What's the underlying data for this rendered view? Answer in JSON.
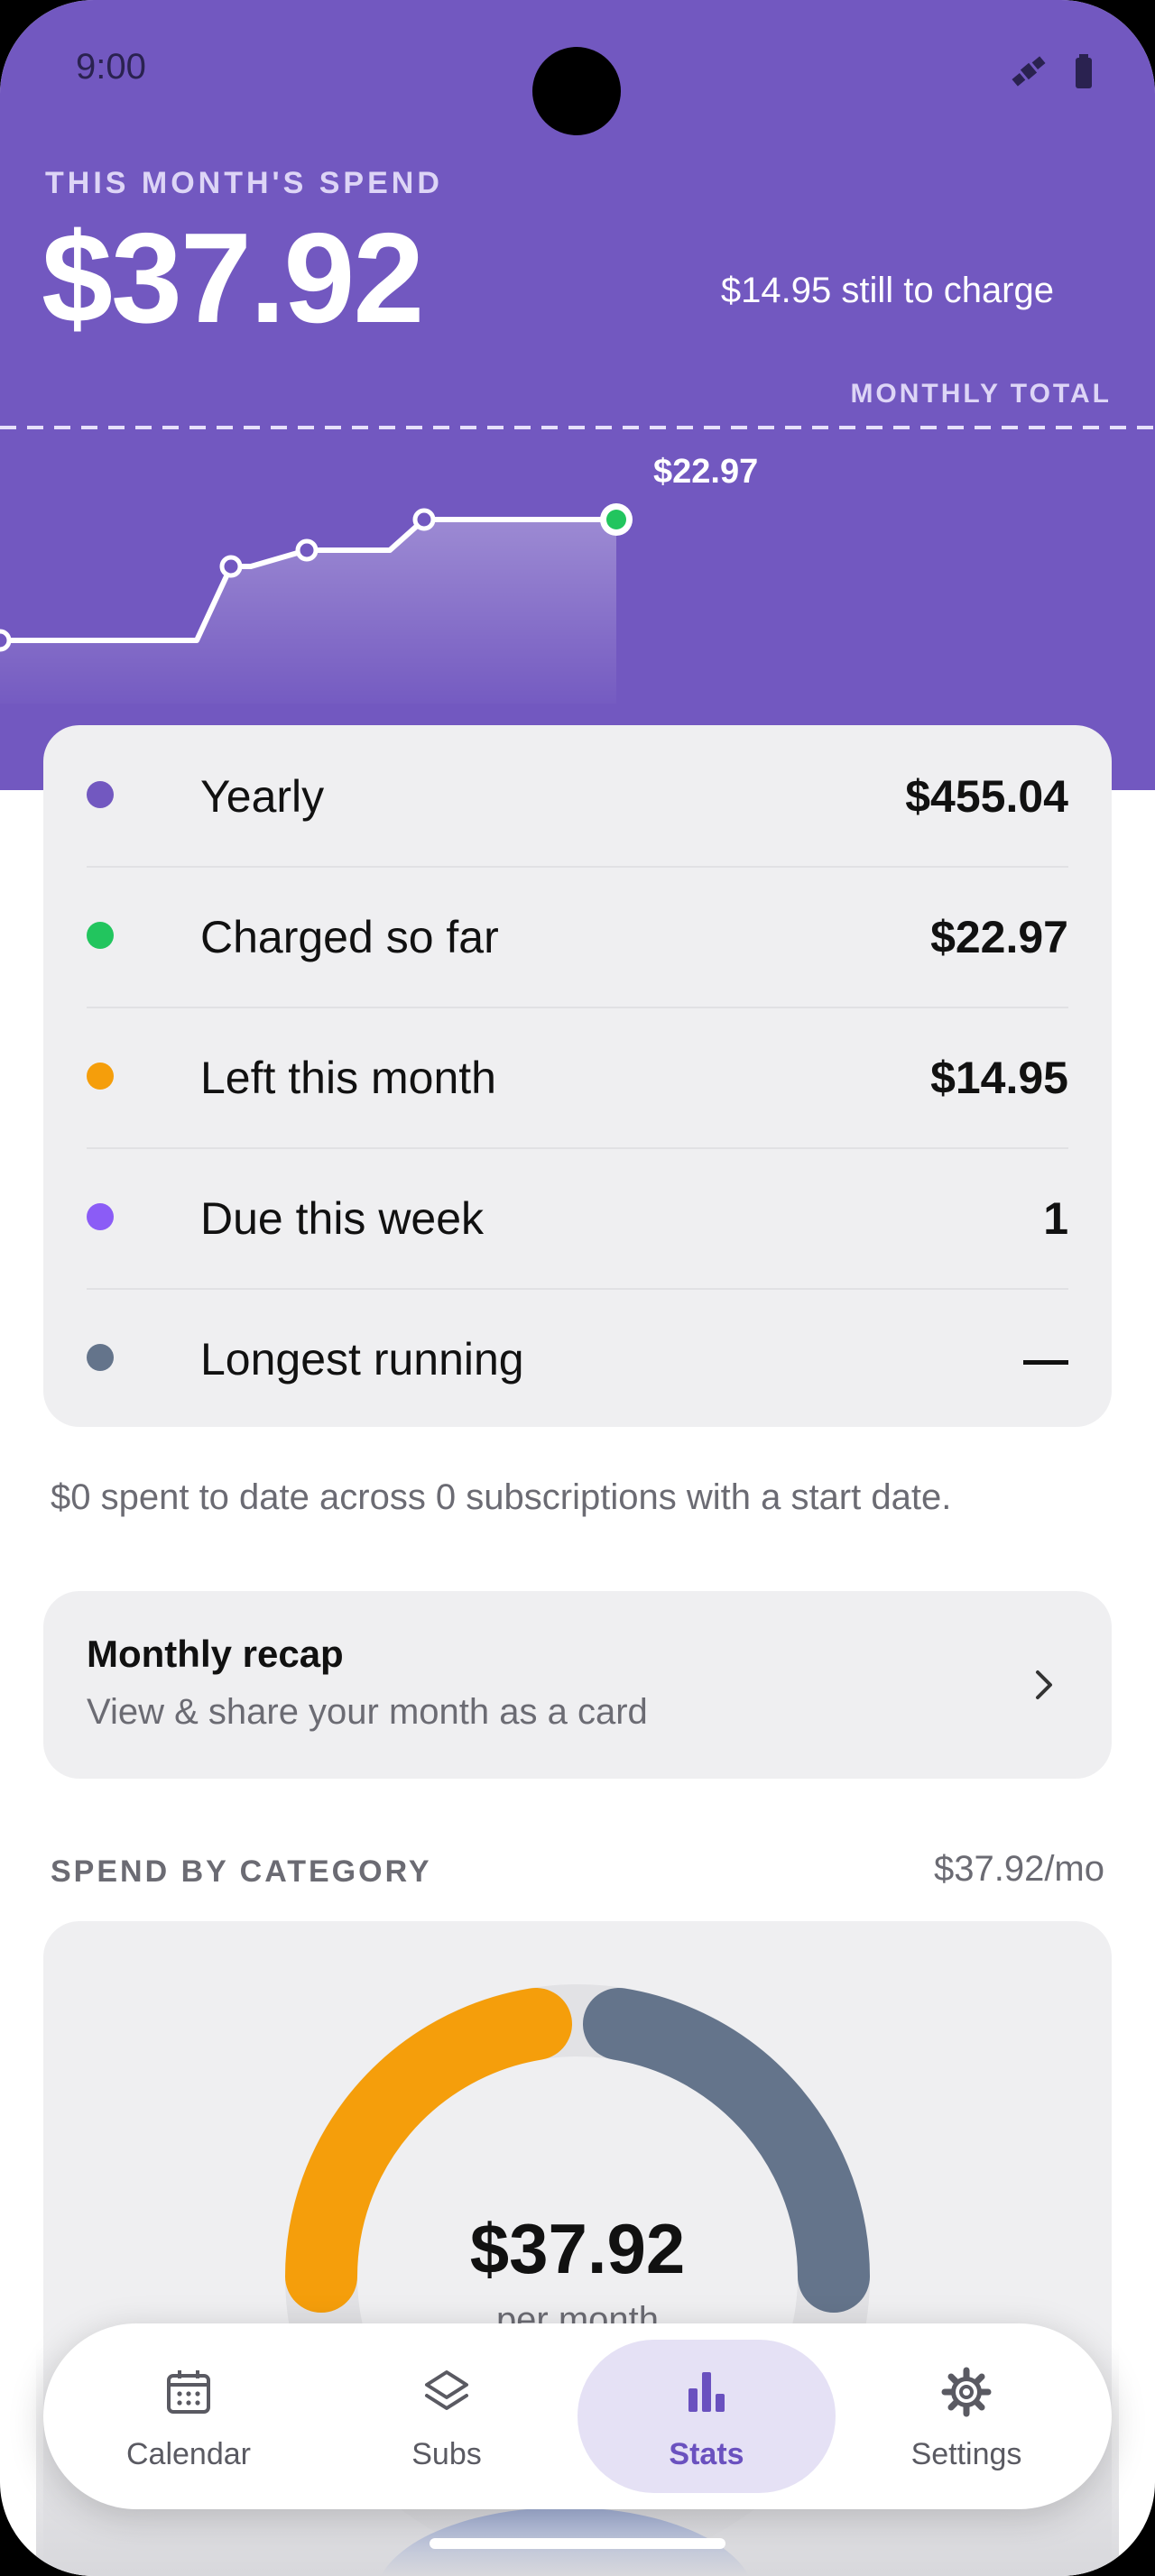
{
  "status_bar": {
    "time": "9:00",
    "icons": [
      "satellite-icon",
      "battery-icon"
    ]
  },
  "hero": {
    "label": "THIS MONTH'S SPEND",
    "amount": "$37.92",
    "remaining": "$14.95 still to charge",
    "total_label": "MONTHLY TOTAL",
    "chart_value_label": "$22.97"
  },
  "stats": [
    {
      "label": "Yearly",
      "value": "$455.04",
      "color": "#7258C0"
    },
    {
      "label": "Charged so far",
      "value": "$22.97",
      "color": "#22C55E"
    },
    {
      "label": "Left this month",
      "value": "$14.95",
      "color": "#F59E0B"
    },
    {
      "label": "Due this week",
      "value": "1",
      "color": "#8B5CF6"
    },
    {
      "label": "Longest running",
      "value": "—",
      "color": "#64748B"
    }
  ],
  "note": "$0 spent to date across 0 subscriptions with a start date.",
  "recap": {
    "title": "Monthly recap",
    "subtitle": "View & share your month as a card"
  },
  "category": {
    "label": "SPEND BY CATEGORY",
    "total": "$37.92/mo",
    "donut_amount": "$37.92",
    "donut_caption": "per month",
    "segments": [
      {
        "color": "#F59E0B",
        "share": 0.5
      },
      {
        "color": "#64748B",
        "share": 0.5
      }
    ]
  },
  "nav": {
    "items": [
      {
        "label": "Calendar",
        "icon": "calendar-icon",
        "active": false
      },
      {
        "label": "Subs",
        "icon": "layers-icon",
        "active": false
      },
      {
        "label": "Stats",
        "icon": "bar-chart-icon",
        "active": true
      },
      {
        "label": "Settings",
        "icon": "gear-icon",
        "active": false
      }
    ]
  },
  "colors": {
    "accent": "#7258C0",
    "card": "#EFEFF1",
    "active_tab": "#6A51BF"
  }
}
